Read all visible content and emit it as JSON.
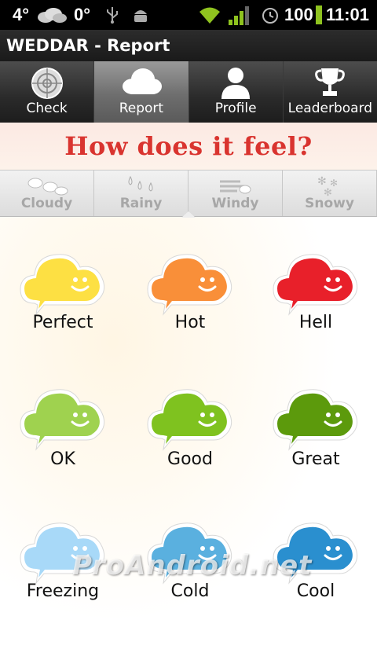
{
  "status_bar": {
    "temp_left": "4°",
    "temp_right": "0°",
    "battery": "100",
    "time": "11:01",
    "icons": [
      "cloud-icon",
      "usb-icon",
      "android-icon",
      "wifi-icon",
      "signal-icon",
      "alarm-icon",
      "battery-icon"
    ]
  },
  "title_bar": {
    "title": "WEDDAR - Report"
  },
  "tabs": [
    {
      "label": "Check",
      "icon": "radar-icon",
      "active": false
    },
    {
      "label": "Report",
      "icon": "cloud-icon",
      "active": true
    },
    {
      "label": "Profile",
      "icon": "person-icon",
      "active": false
    },
    {
      "label": "Leaderboard",
      "icon": "trophy-icon",
      "active": false
    }
  ],
  "heading": "How does it feel?",
  "filters": [
    {
      "label": "Cloudy",
      "icon": "clouds-icon"
    },
    {
      "label": "Rainy",
      "icon": "raindrops-icon"
    },
    {
      "label": "Windy",
      "icon": "wind-icon"
    },
    {
      "label": "Snowy",
      "icon": "snowflake-icon"
    }
  ],
  "moods": [
    {
      "label": "Perfect",
      "color": "#fde043"
    },
    {
      "label": "Hot",
      "color": "#f98f39"
    },
    {
      "label": "Hell",
      "color": "#e8202a"
    },
    {
      "label": "OK",
      "color": "#9fd24f"
    },
    {
      "label": "Good",
      "color": "#7fc21f"
    },
    {
      "label": "Great",
      "color": "#5c9a0c"
    },
    {
      "label": "Freezing",
      "color": "#a8d9f8"
    },
    {
      "label": "Cold",
      "color": "#5ab0df"
    },
    {
      "label": "Cool",
      "color": "#2a8fcf"
    }
  ],
  "watermark": "ProAndroid.net"
}
